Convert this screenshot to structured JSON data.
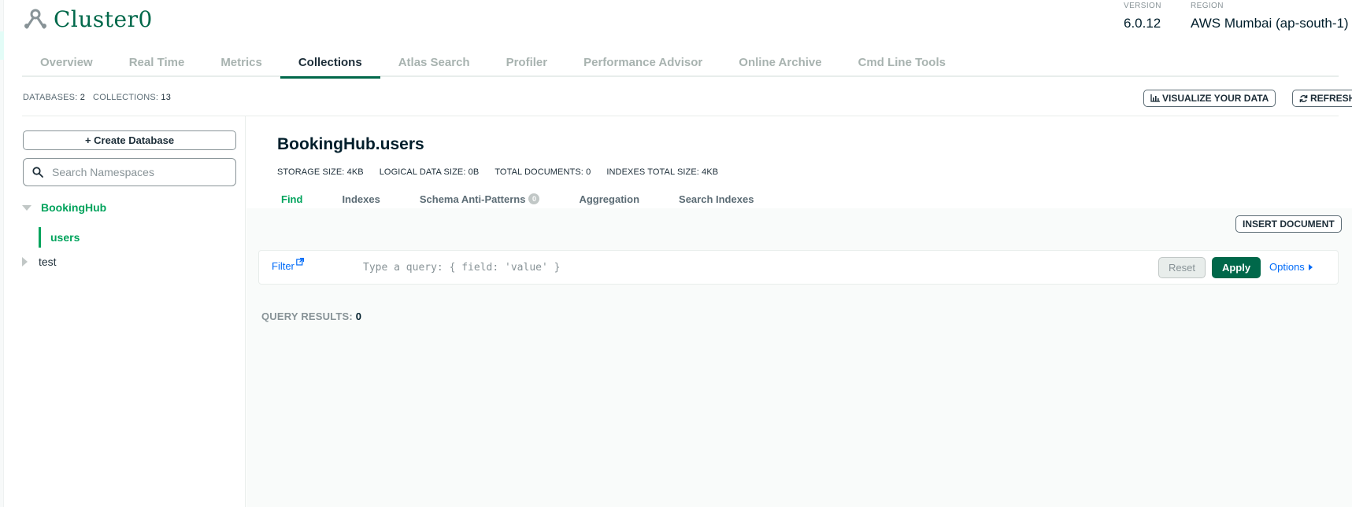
{
  "header": {
    "cluster_name": "Cluster0",
    "cluster_icon": "cluster-icon",
    "version_label": "VERSION",
    "version_value": "6.0.12",
    "region_label": "REGION",
    "region_value": "AWS Mumbai (ap-south-1)"
  },
  "tabs": [
    {
      "label": "Overview",
      "active": false
    },
    {
      "label": "Real Time",
      "active": false
    },
    {
      "label": "Metrics",
      "active": false
    },
    {
      "label": "Collections",
      "active": true
    },
    {
      "label": "Atlas Search",
      "active": false
    },
    {
      "label": "Profiler",
      "active": false
    },
    {
      "label": "Performance Advisor",
      "active": false
    },
    {
      "label": "Online Archive",
      "active": false
    },
    {
      "label": "Cmd Line Tools",
      "active": false
    }
  ],
  "stats": {
    "databases_label": "DATABASES:",
    "databases_value": "2",
    "collections_label": "COLLECTIONS:",
    "collections_value": "13",
    "visualize_label": "VISUALIZE YOUR DATA",
    "visualize_icon": "bar-chart-icon",
    "refresh_label": "REFRESH",
    "refresh_icon": "refresh-icon"
  },
  "sidebar": {
    "create_db_label": "+ Create Database",
    "search_placeholder": "Search Namespaces",
    "databases": [
      {
        "name": "BookingHub",
        "expanded": true,
        "collections": [
          "users"
        ]
      },
      {
        "name": "test",
        "expanded": false,
        "collections": []
      }
    ]
  },
  "main": {
    "namespace": "BookingHub.users",
    "storage_size_label": "STORAGE SIZE:",
    "storage_size": "4KB",
    "logical_size_label": "LOGICAL DATA SIZE:",
    "logical_size": "0B",
    "total_docs_label": "TOTAL DOCUMENTS:",
    "total_docs": "0",
    "indexes_size_label": "INDEXES TOTAL SIZE:",
    "indexes_size": "4KB",
    "subtabs": [
      {
        "label": "Find",
        "active": true
      },
      {
        "label": "Indexes",
        "active": false
      },
      {
        "label": "Schema Anti-Patterns",
        "active": false,
        "badge": "0"
      },
      {
        "label": "Aggregation",
        "active": false
      },
      {
        "label": "Search Indexes",
        "active": false
      }
    ],
    "insert_label": "INSERT DOCUMENT",
    "filter_label": "Filter",
    "query_placeholder": "Type a query: { field: 'value' }",
    "reset_label": "Reset",
    "apply_label": "Apply",
    "options_label": "Options",
    "results_label": "QUERY RESULTS:",
    "results_value": "0"
  },
  "colors": {
    "brand_green": "#00684a",
    "accent_green": "#00a35c",
    "link_blue": "#016bf8"
  }
}
